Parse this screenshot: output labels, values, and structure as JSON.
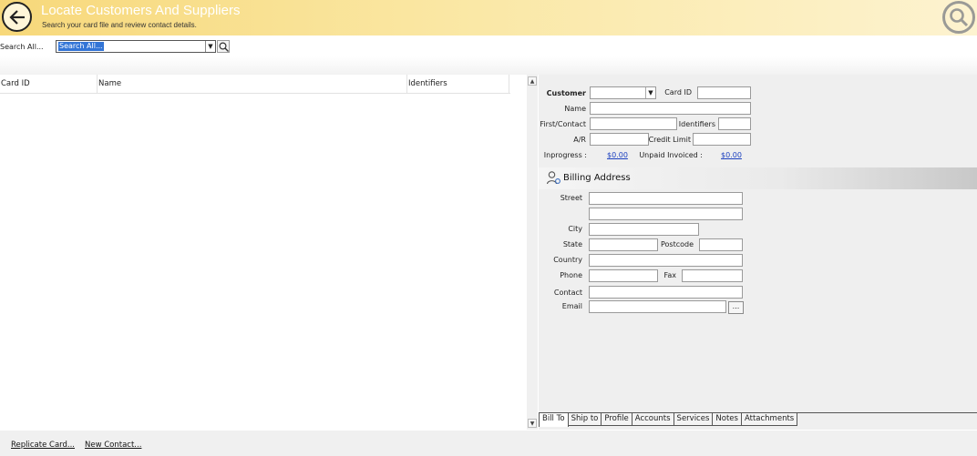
{
  "header": {
    "title": "Locate Customers And Suppliers",
    "subtitle": "Search your card file and review contact details."
  },
  "search": {
    "label": "Search All...",
    "value": "Search All..."
  },
  "grid": {
    "columns": [
      "Card ID",
      "Name",
      "Identifiers"
    ],
    "rows": []
  },
  "detail": {
    "customer_label": "Customer",
    "card_id_label": "Card ID",
    "name_label": "Name",
    "first_contact_label": "First/Contact",
    "identifiers_label": "Identifiers",
    "ar_label": "A/R",
    "credit_limit_label": "Credit Limit",
    "inprogress_label": "Inprogress :",
    "inprogress_value": "$0.00",
    "unpaid_label": "Unpaid Invoiced :",
    "unpaid_value": "$0.00",
    "billing_title": "Billing Address",
    "street_label": "Street",
    "city_label": "City",
    "state_label": "State",
    "postcode_label": "Postcode",
    "country_label": "Country",
    "phone_label": "Phone",
    "fax_label": "Fax",
    "contact_label": "Contact",
    "email_label": "Email",
    "ellipsis": "..."
  },
  "tabs": [
    {
      "label": "Bill To",
      "active": true
    },
    {
      "label": "Ship to",
      "active": false
    },
    {
      "label": "Profile",
      "active": false
    },
    {
      "label": "Accounts",
      "active": false
    },
    {
      "label": "Services",
      "active": false
    },
    {
      "label": "Notes",
      "active": false
    },
    {
      "label": "Attachments",
      "active": false
    }
  ],
  "footer": {
    "replicate": "Replicate Card...",
    "new_contact": "New Contact..."
  },
  "icons": {
    "back": "back-arrow-icon",
    "search": "magnifier-icon",
    "billing": "person-icon"
  },
  "colors": {
    "header_start": "#f7d87a",
    "header_end": "#fdf3d0",
    "selection": "#3375d6",
    "link": "#1a3fbf"
  }
}
